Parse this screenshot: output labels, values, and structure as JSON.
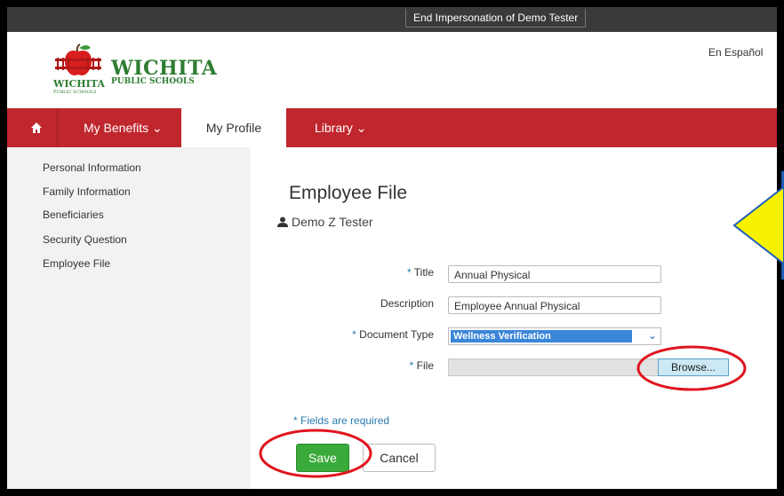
{
  "impersonation": {
    "label": "End Impersonation of Demo Tester"
  },
  "header": {
    "logo_name": "WICHITA",
    "logo_sub": "PUBLIC SCHOOLS",
    "logo_small_name": "WICHITA",
    "logo_small_sub": "PUBLIC SCHOOLS",
    "language_link": "En Español"
  },
  "nav": {
    "home_icon": "home-icon",
    "items": [
      {
        "label": "My Benefits ⌄"
      },
      {
        "label": "My Profile"
      },
      {
        "label": "Library ⌄"
      }
    ]
  },
  "sidebar": {
    "items": [
      {
        "label": "Personal Information"
      },
      {
        "label": "Family Information"
      },
      {
        "label": "Beneficiaries"
      },
      {
        "label": "Security Question"
      },
      {
        "label": "Employee File"
      }
    ]
  },
  "main": {
    "title": "Employee File",
    "user_icon": "person-icon",
    "user_name": "Demo Z Tester",
    "form": {
      "title_label": "Title",
      "title_value": "Annual Physical",
      "description_label": "Description",
      "description_value": "Employee Annual Physical",
      "doc_type_label": "Document Type",
      "doc_type_value": "Wellness Verification",
      "file_label": "File",
      "browse_label": "Browse..."
    },
    "required_star": "*",
    "required_note": "Fields are required",
    "save_label": "Save",
    "cancel_label": "Cancel"
  },
  "colors": {
    "nav_red": "#c0262d",
    "save_green": "#3aaa3a",
    "highlight_red": "#e0141e",
    "arrow_yellow": "#f6f200"
  }
}
